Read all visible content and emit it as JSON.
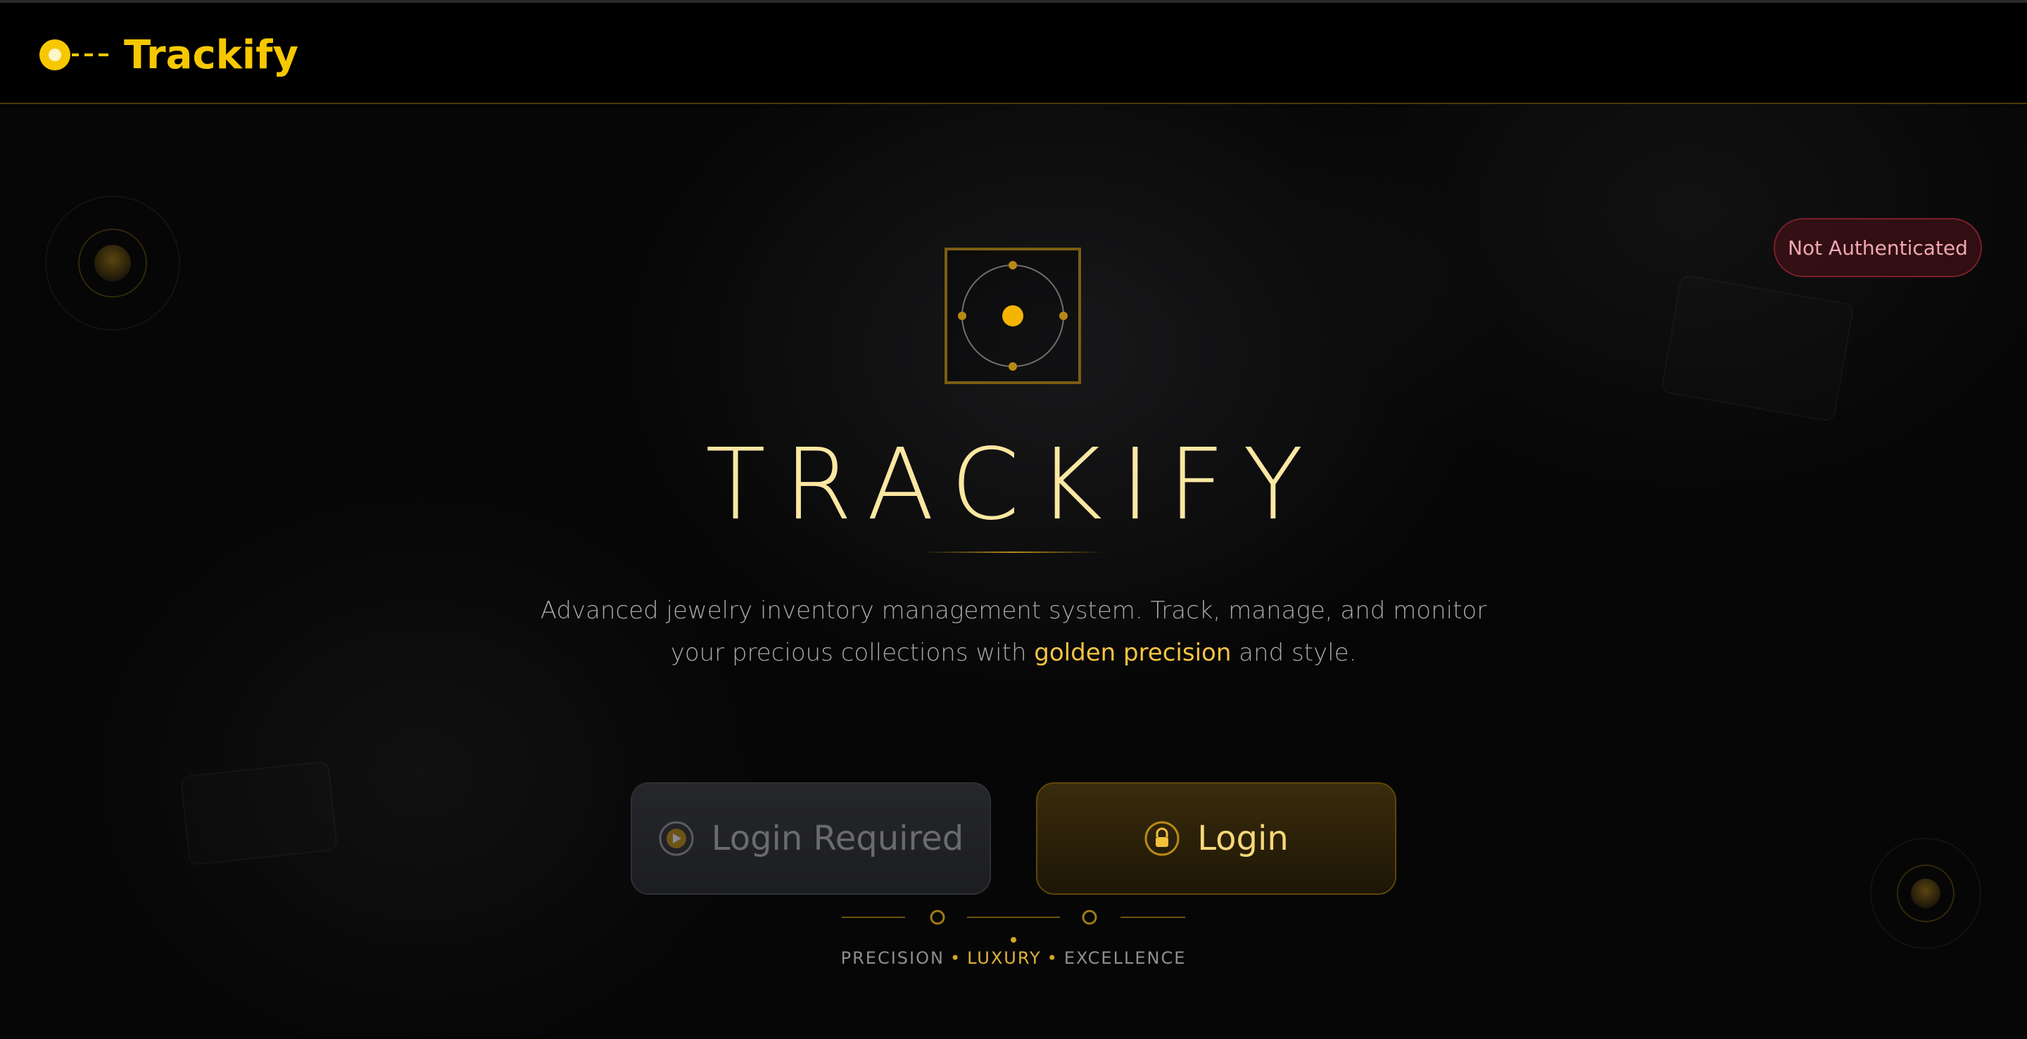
{
  "app": {
    "brand_name": "Trackify",
    "accent_color": "#f7c800"
  },
  "status": {
    "label": "Not Authenticated",
    "color": "#f2a7b0"
  },
  "hero": {
    "title": "TRACKIFY",
    "tagline_before": "Advanced jewelry inventory management system. Track, manage, and monitor your precious collections with ",
    "tagline_highlight": "golden precision",
    "tagline_after": " and style."
  },
  "actions": {
    "login_required_label": "Login Required",
    "login_label": "Login",
    "login_required_icon": "play-icon",
    "login_icon": "lock-icon"
  },
  "footer": {
    "motto": [
      "PRECISION",
      "LUXURY",
      "EXCELLENCE"
    ],
    "separator": "•"
  }
}
